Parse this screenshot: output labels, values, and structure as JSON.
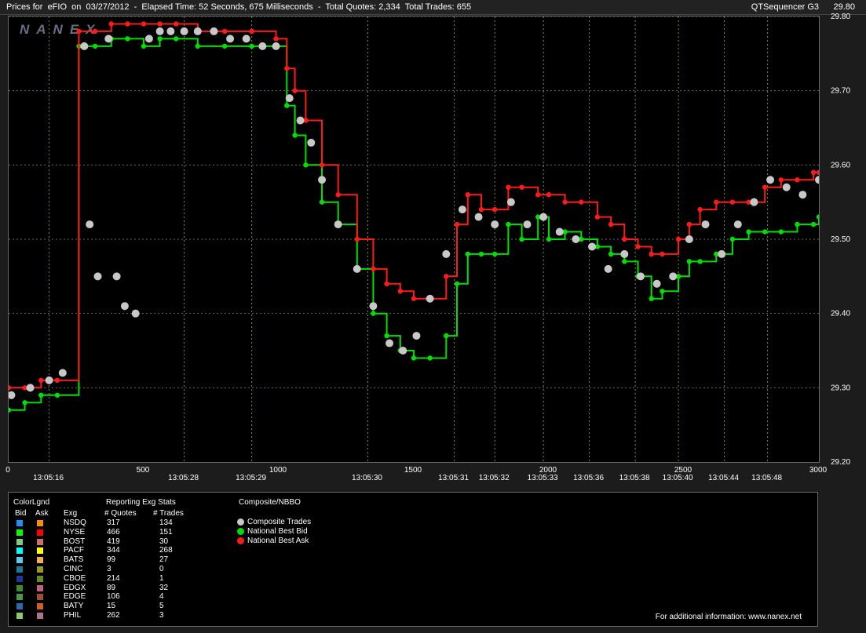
{
  "header": {
    "title": "Prices for  eFIO  on  03/27/2012  -  Elapsed Time: 52 Seconds, 675 Milliseconds  -  Total Quotes: 2,334  Total Trades: 655",
    "app": "QTSequencer G3",
    "top_price": "29.80"
  },
  "watermark": "NANEX",
  "chart_data": {
    "type": "line",
    "ylim": [
      29.2,
      29.8
    ],
    "xlim": [
      0,
      3000
    ],
    "y_ticks": [
      "29.30",
      "29.40",
      "29.50",
      "29.60",
      "29.70",
      "29.80"
    ],
    "y_bottom_label": "29.20",
    "x_ticks": [
      "0",
      "500",
      "1000",
      "1500",
      "2000",
      "2500",
      "3000"
    ],
    "time_ticks": [
      {
        "x": 150,
        "label": "13:05:16"
      },
      {
        "x": 650,
        "label": "13:05:28"
      },
      {
        "x": 900,
        "label": "13:05:29"
      },
      {
        "x": 1330,
        "label": "13:05:30"
      },
      {
        "x": 1650,
        "label": "13:05:31"
      },
      {
        "x": 1800,
        "label": "13:05:32"
      },
      {
        "x": 1980,
        "label": "13:05:33"
      },
      {
        "x": 2150,
        "label": "13:05:36"
      },
      {
        "x": 2320,
        "label": "13:05:38"
      },
      {
        "x": 2480,
        "label": "13:05:40"
      },
      {
        "x": 2650,
        "label": "13:05:44"
      },
      {
        "x": 2810,
        "label": "13:05:48"
      }
    ],
    "series": [
      {
        "name": "National Best Bid",
        "color": "#00e000",
        "x": [
          0,
          60,
          120,
          180,
          260,
          320,
          380,
          440,
          500,
          560,
          620,
          700,
          800,
          900,
          990,
          1030,
          1060,
          1100,
          1160,
          1220,
          1290,
          1350,
          1400,
          1450,
          1500,
          1560,
          1620,
          1660,
          1700,
          1750,
          1800,
          1850,
          1900,
          1960,
          2000,
          2060,
          2120,
          2180,
          2230,
          2280,
          2330,
          2380,
          2420,
          2480,
          2520,
          2560,
          2620,
          2680,
          2740,
          2800,
          2860,
          2920,
          2980,
          3000
        ],
        "y": [
          29.27,
          29.28,
          29.29,
          29.29,
          29.76,
          29.76,
          29.77,
          29.77,
          29.76,
          29.77,
          29.77,
          29.76,
          29.76,
          29.76,
          29.76,
          29.68,
          29.64,
          29.6,
          29.55,
          29.52,
          29.46,
          29.4,
          29.37,
          29.35,
          29.34,
          29.34,
          29.37,
          29.44,
          29.48,
          29.48,
          29.48,
          29.52,
          29.5,
          29.53,
          29.5,
          29.51,
          29.5,
          29.49,
          29.48,
          29.47,
          29.45,
          29.42,
          29.43,
          29.45,
          29.47,
          29.47,
          29.48,
          29.5,
          29.51,
          29.51,
          29.51,
          29.52,
          29.52,
          29.53
        ]
      },
      {
        "name": "National Best Ask",
        "color": "#ff1a1a",
        "x": [
          0,
          60,
          120,
          180,
          260,
          320,
          380,
          440,
          500,
          560,
          620,
          700,
          800,
          900,
          990,
          1030,
          1060,
          1100,
          1160,
          1220,
          1290,
          1350,
          1400,
          1450,
          1500,
          1560,
          1620,
          1660,
          1700,
          1750,
          1800,
          1850,
          1900,
          1960,
          2000,
          2060,
          2120,
          2180,
          2230,
          2280,
          2330,
          2380,
          2420,
          2480,
          2520,
          2560,
          2620,
          2680,
          2740,
          2800,
          2860,
          2920,
          2980,
          3000
        ],
        "y": [
          29.3,
          29.3,
          29.31,
          29.31,
          29.78,
          29.78,
          29.79,
          29.79,
          29.79,
          29.79,
          29.79,
          29.78,
          29.78,
          29.78,
          29.77,
          29.73,
          29.7,
          29.66,
          29.6,
          29.56,
          29.5,
          29.46,
          29.44,
          29.43,
          29.42,
          29.42,
          29.45,
          29.52,
          29.56,
          29.54,
          29.54,
          29.57,
          29.57,
          29.56,
          29.56,
          29.55,
          29.55,
          29.53,
          29.52,
          29.5,
          29.49,
          29.48,
          29.48,
          29.5,
          29.52,
          29.54,
          29.55,
          29.55,
          29.55,
          29.57,
          29.58,
          29.58,
          29.59,
          29.59
        ]
      },
      {
        "name": "Composite Trades",
        "color": "#c8c8c8",
        "x": [
          10,
          80,
          150,
          200,
          280,
          300,
          330,
          370,
          400,
          430,
          470,
          520,
          560,
          600,
          650,
          700,
          760,
          820,
          880,
          940,
          990,
          1040,
          1080,
          1120,
          1160,
          1220,
          1290,
          1350,
          1410,
          1460,
          1510,
          1560,
          1620,
          1680,
          1740,
          1800,
          1860,
          1920,
          1980,
          2040,
          2100,
          2160,
          2220,
          2280,
          2340,
          2400,
          2460,
          2520,
          2580,
          2640,
          2700,
          2760,
          2820,
          2880,
          2940,
          3000
        ],
        "y": [
          29.29,
          29.3,
          29.31,
          29.32,
          29.76,
          29.52,
          29.45,
          29.77,
          29.45,
          29.41,
          29.4,
          29.77,
          29.78,
          29.78,
          29.78,
          29.78,
          29.78,
          29.77,
          29.77,
          29.76,
          29.76,
          29.69,
          29.66,
          29.63,
          29.58,
          29.52,
          29.46,
          29.41,
          29.36,
          29.35,
          29.37,
          29.42,
          29.48,
          29.54,
          29.53,
          29.52,
          29.55,
          29.52,
          29.53,
          29.51,
          29.5,
          29.49,
          29.46,
          29.48,
          29.45,
          29.44,
          29.45,
          29.5,
          29.52,
          29.48,
          29.52,
          29.55,
          29.58,
          29.57,
          29.56,
          29.58
        ]
      }
    ]
  },
  "legend": {
    "header": {
      "colorlgnd": "ColorLgnd",
      "stats": "Reporting Exg Stats",
      "nbbo": "Composite/NBBO"
    },
    "cols": {
      "bid": "Bid",
      "ask": "Ask",
      "exg": "Exg",
      "quotes": "# Quotes",
      "trades": "# Trades"
    },
    "rows": [
      {
        "exg": "NSDQ",
        "quotes": "317",
        "trades": "134",
        "bid": "#1e8fff",
        "ask": "#ff8c00"
      },
      {
        "exg": "NYSE",
        "quotes": "466",
        "trades": "151",
        "bid": "#00ff00",
        "ask": "#ff0000"
      },
      {
        "exg": "BOST",
        "quotes": "419",
        "trades": "30",
        "bid": "#7ccd7c",
        "ask": "#cd6f6f"
      },
      {
        "exg": "PACF",
        "quotes": "344",
        "trades": "268",
        "bid": "#00ffff",
        "ask": "#ffff00"
      },
      {
        "exg": "BATS",
        "quotes": "99",
        "trades": "27",
        "bid": "#5cc8f0",
        "ask": "#f0b050"
      },
      {
        "exg": "CINC",
        "quotes": "3",
        "trades": "0",
        "bid": "#1a7a9a",
        "ask": "#9a9a1a"
      },
      {
        "exg": "CBOE",
        "quotes": "214",
        "trades": "1",
        "bid": "#1a3a9a",
        "ask": "#6a8a1a"
      },
      {
        "exg": "EDGX",
        "quotes": "89",
        "trades": "32",
        "bid": "#3a8a3a",
        "ask": "#c06080"
      },
      {
        "exg": "EDGE",
        "quotes": "106",
        "trades": "4",
        "bid": "#4a9a4a",
        "ask": "#a05030"
      },
      {
        "exg": "BATY",
        "quotes": "15",
        "trades": "5",
        "bid": "#2a6ab0",
        "ask": "#d06020"
      },
      {
        "exg": "PHIL",
        "quotes": "262",
        "trades": "3",
        "bid": "#8aca6a",
        "ask": "#b07090"
      }
    ],
    "nbbo": [
      {
        "label": "Composite Trades",
        "color": "#c8c8c8"
      },
      {
        "label": "National Best Bid",
        "color": "#00e000"
      },
      {
        "label": "National Best Ask",
        "color": "#ff1a1a"
      }
    ],
    "footer": "For additional information: www.nanex.net"
  }
}
